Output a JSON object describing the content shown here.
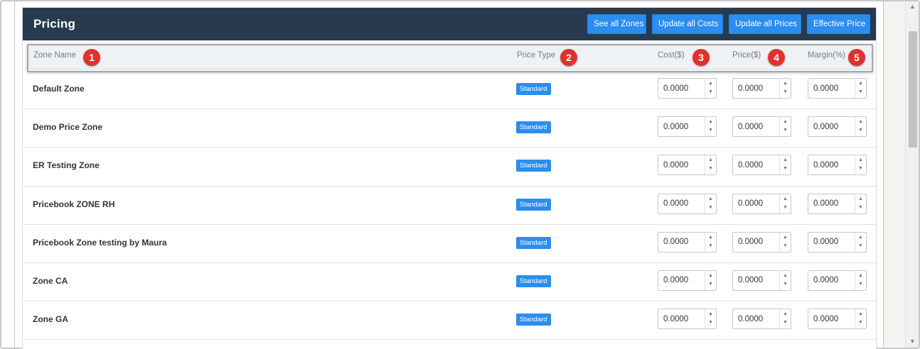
{
  "panel": {
    "title": "Pricing",
    "buttons": [
      {
        "label": "See all Zones"
      },
      {
        "label": "Update all Costs"
      },
      {
        "label": "Update all Prices"
      },
      {
        "label": "Effective Price"
      }
    ]
  },
  "columns": {
    "zone_name": "Zone Name",
    "price_type": "Price Type",
    "cost": "Cost($)",
    "price": "Price($)",
    "margin": "Margin(%)"
  },
  "callouts": [
    "1",
    "2",
    "3",
    "4",
    "5"
  ],
  "rows": [
    {
      "zone": "Default Zone",
      "price_type": "Standard",
      "cost": "0.0000",
      "price": "0.0000",
      "margin": "0.0000"
    },
    {
      "zone": "Demo Price Zone",
      "price_type": "Standard",
      "cost": "0.0000",
      "price": "0.0000",
      "margin": "0.0000"
    },
    {
      "zone": "ER Testing Zone",
      "price_type": "Standard",
      "cost": "0.0000",
      "price": "0.0000",
      "margin": "0.0000"
    },
    {
      "zone": "Pricebook ZONE RH",
      "price_type": "Standard",
      "cost": "0.0000",
      "price": "0.0000",
      "margin": "0.0000"
    },
    {
      "zone": "Pricebook Zone testing by Maura",
      "price_type": "Standard",
      "cost": "0.0000",
      "price": "0.0000",
      "margin": "0.0000"
    },
    {
      "zone": "Zone CA",
      "price_type": "Standard",
      "cost": "0.0000",
      "price": "0.0000",
      "margin": "0.0000"
    },
    {
      "zone": "Zone GA",
      "price_type": "Standard",
      "cost": "0.0000",
      "price": "0.0000",
      "margin": "0.0000"
    }
  ],
  "colors": {
    "header_bg": "#273a50",
    "accent": "#2b8df0",
    "callout": "#e0312c"
  },
  "icons": {
    "spin_up": "triangle-up-icon",
    "spin_down": "triangle-down-icon",
    "scroll_up": "scroll-up-arrow-icon",
    "scroll_down": "scroll-down-arrow-icon"
  }
}
